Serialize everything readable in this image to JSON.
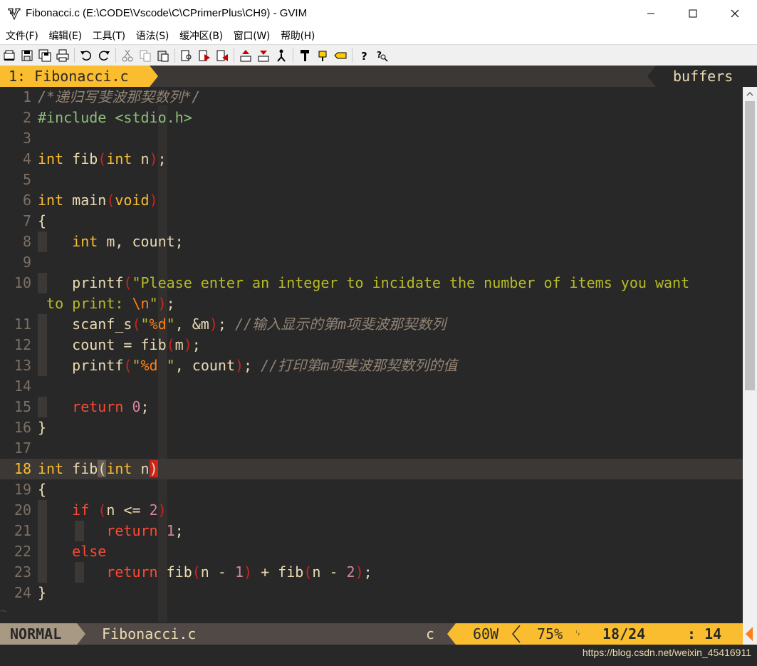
{
  "window": {
    "title": "Fibonacci.c (E:\\CODE\\Vscode\\C\\CPrimerPlus\\CH9) - GVIM"
  },
  "menu": [
    "文件(F)",
    "编辑(E)",
    "工具(T)",
    "语法(S)",
    "缓冲区(B)",
    "窗口(W)",
    "帮助(H)"
  ],
  "toolbar_icons": [
    "open-icon",
    "save-icon",
    "save-all-icon",
    "print-icon",
    "undo-icon",
    "redo-icon",
    "cut-icon",
    "copy-icon",
    "paste-icon",
    "find-icon",
    "find-next-icon",
    "find-prev-icon",
    "load-session-icon",
    "save-session-icon",
    "run-script-icon",
    "make-icon",
    "run-ctags-icon",
    "jump-tag-icon",
    "help-icon",
    "find-help-icon"
  ],
  "tabline": {
    "active_tab": "1: Fibonacci.c",
    "buffers_label": "buffers"
  },
  "colors": {
    "background": "#282828",
    "keyword": "#fabd2f",
    "return_keyword": "#fb4934",
    "include": "#8ec07c",
    "string": "#b8bb26",
    "number": "#d3869b",
    "comment": "#928374"
  },
  "code_text": {
    "l1": "/*递归写斐波那契数列*/",
    "l2_kw": "#include",
    "l2_rest": " <stdio.h>",
    "l11_cm": "//输入显示的第m项斐波那契数列",
    "l13_cm": "//打印第m项斐波那契数列的值",
    "l10_str1": "\"Please enter an integer to incidate the number of items you want",
    "l10_str2": "to print: ",
    "l10_esc": "\\n"
  },
  "statusline": {
    "mode": "NORMAL",
    "filename": "Fibonacci.c",
    "filetype": "c",
    "word_count": "60W",
    "percent": "75%",
    "line_icon": "␊",
    "position": "18/24",
    "column": ": 14"
  },
  "watermark": "https://blog.csdn.net/weixin_45416911"
}
